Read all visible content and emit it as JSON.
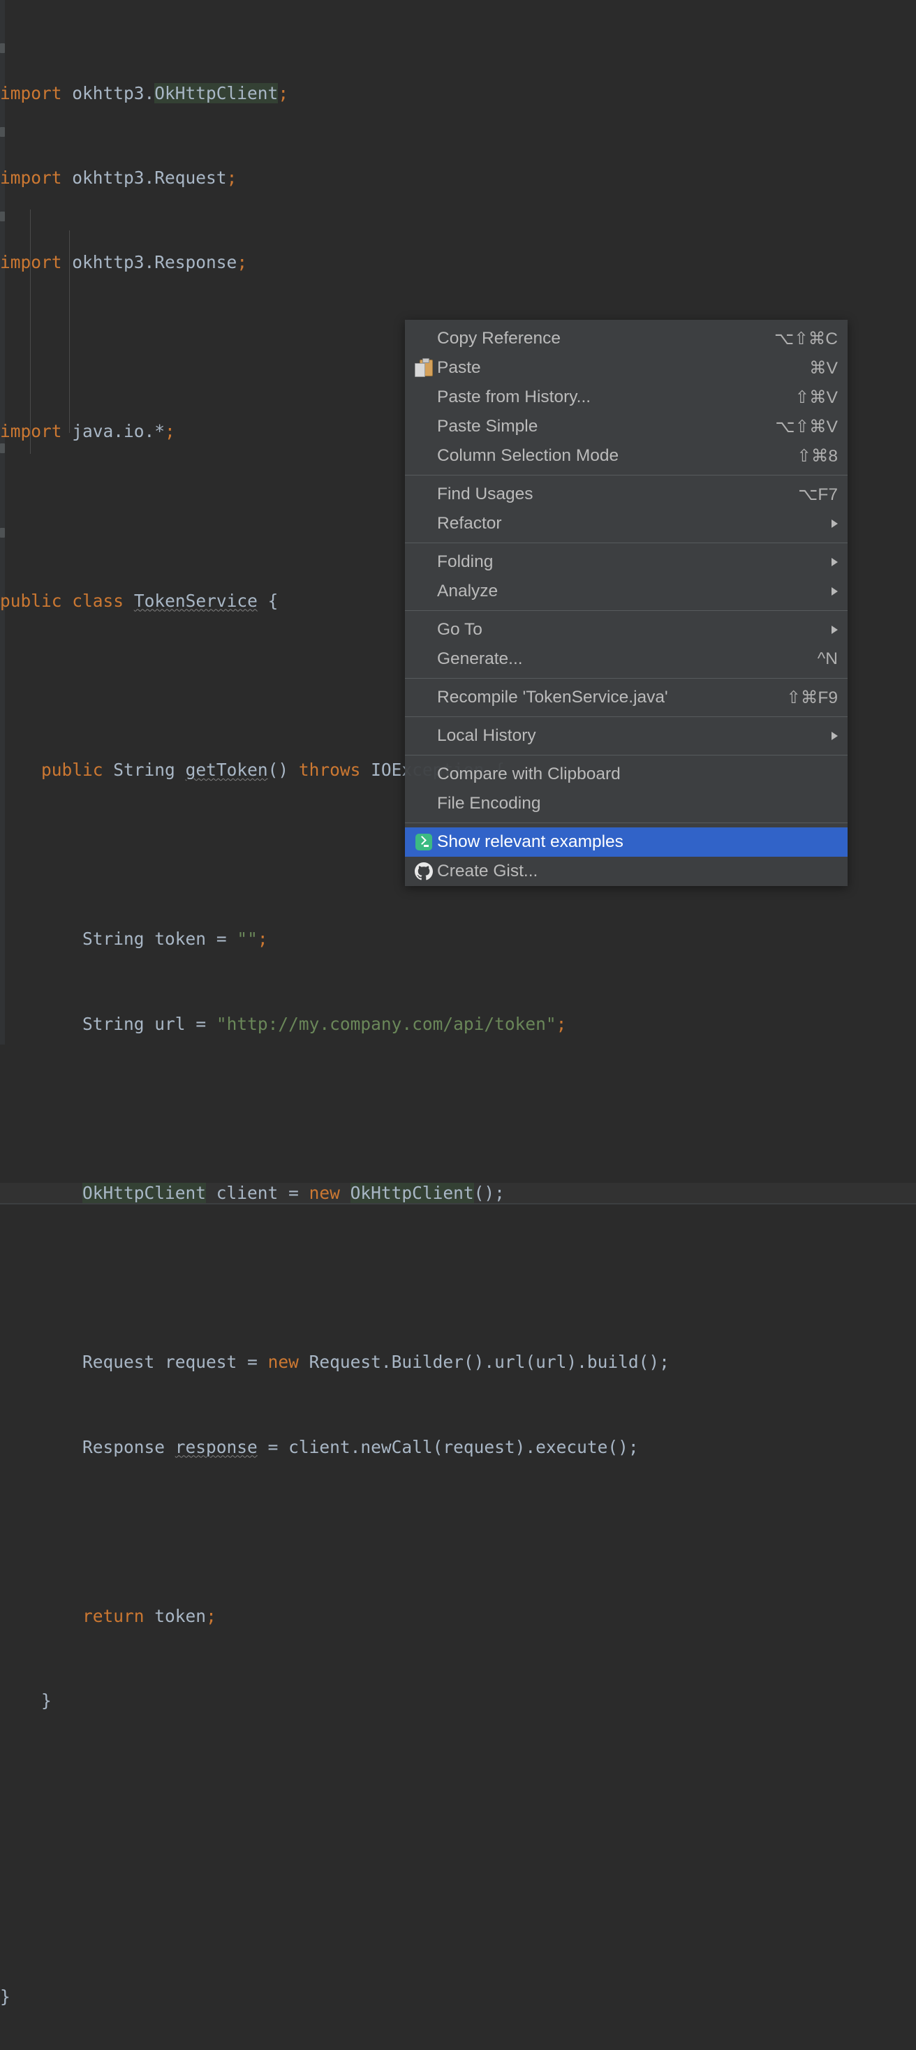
{
  "editor": {
    "theme_bg": "#2b2b2b",
    "current_line_bg": "#323232",
    "file_name": "TokenService.java",
    "colors": {
      "keyword": "#cc7832",
      "string": "#6a8759",
      "identifier": "#a9b7c6",
      "usage_highlight": "#344134",
      "selection_blue": "#3163c8"
    },
    "code_lines": [
      "import okhttp3.OkHttpClient;",
      "import okhttp3.Request;",
      "import okhttp3.Response;",
      "",
      "import java.io.*;",
      "",
      "public class TokenService {",
      "",
      "    public String getToken() throws IOException {",
      "",
      "        String token = \"\";",
      "        String url = \"http://my.company.com/api/token\";",
      "",
      "        OkHttpClient client = new OkHttpClient();",
      "",
      "        Request request = new Request.Builder().url(url).build();",
      "        Response response = client.newCall(request).execute();",
      "",
      "        return token;",
      "    }",
      "",
      "",
      "}"
    ],
    "tokens": {
      "kw_import": "import",
      "kw_public": "public",
      "kw_class": "class",
      "kw_new": "new",
      "kw_throws": "throws",
      "kw_return": "return",
      "pkg_okhttp3": "okhttp3.",
      "cls_OkHttpClient": "OkHttpClient",
      "cls_Request": "Request",
      "cls_Response": "Response",
      "pkg_javaio": "java.io.*",
      "cls_TokenService": "TokenService",
      "type_String": "String",
      "method_getToken": "getToken",
      "exc_IOException": "IOException",
      "var_token": "token",
      "var_url": "url",
      "var_client": "client",
      "var_request": "request",
      "var_response": "response",
      "str_empty": "\"\"",
      "str_url": "\"http://my.company.com/api/token\"",
      "builder_chain": "Request.Builder().url(url).build()",
      "call_chain": "client.newCall(request).execute()"
    }
  },
  "context_menu": {
    "groups": [
      {
        "items": [
          {
            "id": "copy-reference",
            "label": "Copy Reference",
            "accel": "⌥⇧⌘C",
            "icon": null,
            "submenu": false,
            "selected": false
          },
          {
            "id": "paste",
            "label": "Paste",
            "accel": "⌘V",
            "icon": "paste-icon",
            "submenu": false,
            "selected": false
          },
          {
            "id": "paste-from-history",
            "label": "Paste from History...",
            "accel": "⇧⌘V",
            "icon": null,
            "submenu": false,
            "selected": false
          },
          {
            "id": "paste-simple",
            "label": "Paste Simple",
            "accel": "⌥⇧⌘V",
            "icon": null,
            "submenu": false,
            "selected": false
          },
          {
            "id": "column-selection-mode",
            "label": "Column Selection Mode",
            "accel": "⇧⌘8",
            "icon": null,
            "submenu": false,
            "selected": false
          }
        ]
      },
      {
        "items": [
          {
            "id": "find-usages",
            "label": "Find Usages",
            "accel": "⌥F7",
            "icon": null,
            "submenu": false,
            "selected": false
          },
          {
            "id": "refactor",
            "label": "Refactor",
            "accel": "",
            "icon": null,
            "submenu": true,
            "selected": false
          }
        ]
      },
      {
        "items": [
          {
            "id": "folding",
            "label": "Folding",
            "accel": "",
            "icon": null,
            "submenu": true,
            "selected": false
          },
          {
            "id": "analyze",
            "label": "Analyze",
            "accel": "",
            "icon": null,
            "submenu": true,
            "selected": false
          }
        ]
      },
      {
        "items": [
          {
            "id": "go-to",
            "label": "Go To",
            "accel": "",
            "icon": null,
            "submenu": true,
            "selected": false
          },
          {
            "id": "generate",
            "label": "Generate...",
            "accel": "^N",
            "icon": null,
            "submenu": false,
            "selected": false
          }
        ]
      },
      {
        "items": [
          {
            "id": "recompile",
            "label": "Recompile 'TokenService.java'",
            "accel": "⇧⌘F9",
            "icon": null,
            "submenu": false,
            "selected": false
          }
        ]
      },
      {
        "items": [
          {
            "id": "local-history",
            "label": "Local History",
            "accel": "",
            "icon": null,
            "submenu": true,
            "selected": false
          }
        ]
      },
      {
        "items": [
          {
            "id": "compare-with-clipboard",
            "label": "Compare with Clipboard",
            "accel": "",
            "icon": null,
            "submenu": false,
            "selected": false
          },
          {
            "id": "file-encoding",
            "label": "File Encoding",
            "accel": "",
            "icon": null,
            "submenu": false,
            "selected": false
          }
        ]
      },
      {
        "items": [
          {
            "id": "show-relevant-examples",
            "label": "Show relevant examples",
            "accel": "",
            "icon": "console-icon",
            "submenu": false,
            "selected": true
          },
          {
            "id": "create-gist",
            "label": "Create Gist...",
            "accel": "",
            "icon": "github-icon",
            "submenu": false,
            "selected": false
          }
        ]
      }
    ]
  }
}
